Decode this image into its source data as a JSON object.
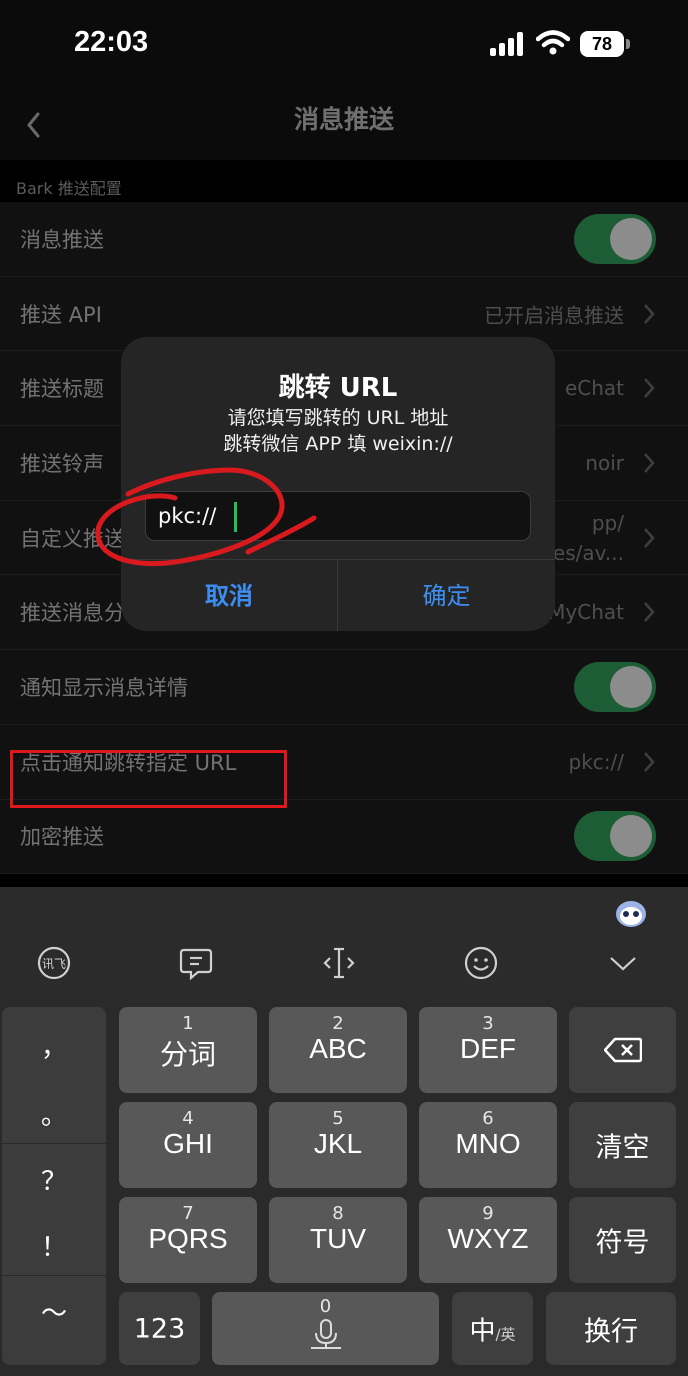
{
  "status": {
    "time": "22:03",
    "battery": "78"
  },
  "nav": {
    "title": "消息推送"
  },
  "section_header": "Bark 推送配置",
  "rows": [
    {
      "label": "消息推送",
      "toggle": true
    },
    {
      "label": "推送 API",
      "value": "已开启消息推送"
    },
    {
      "label": "推送标题",
      "value": "eChat"
    },
    {
      "label": "推送铃声",
      "value": "noir"
    },
    {
      "label": "自定义推送",
      "value_line1": "pp/",
      "value_line2": "es/av..."
    },
    {
      "label": "推送消息分组",
      "value": "MyChat"
    },
    {
      "label": "通知显示消息详情",
      "toggle": true
    },
    {
      "label": "点击通知跳转指定 URL",
      "value": "pkc://"
    },
    {
      "label": "加密推送",
      "toggle": true
    }
  ],
  "dialog": {
    "title": "跳转 URL",
    "message_line1": "请您填写跳转的 URL 地址",
    "message_line2": "跳转微信 APP 填 weixin://",
    "input_value": "pkc://",
    "cancel_label": "取消",
    "confirm_label": "确定"
  },
  "keyboard": {
    "punctuation": [
      "，",
      "。",
      "？",
      "！",
      "～"
    ],
    "keys": [
      {
        "num": "1",
        "main": "分词"
      },
      {
        "num": "2",
        "main": "ABC"
      },
      {
        "num": "3",
        "main": "DEF"
      },
      {
        "num": "4",
        "main": "GHI"
      },
      {
        "num": "5",
        "main": "JKL"
      },
      {
        "num": "6",
        "main": "MNO"
      },
      {
        "num": "7",
        "main": "PQRS"
      },
      {
        "num": "8",
        "main": "TUV"
      },
      {
        "num": "9",
        "main": "WXYZ"
      }
    ],
    "clear_label": "清空",
    "symbol_label": "符号",
    "numbers_label": "123",
    "space_num": "0",
    "lang_main": "中",
    "lang_sub": "/英",
    "return_label": "换行"
  },
  "icons": [
    "back-chevron-icon",
    "signal-icon",
    "wifi-icon",
    "battery-icon",
    "chevron-right-icon",
    "xunfei-voice-icon",
    "comment-icon",
    "cursor-icon",
    "emoji-icon",
    "collapse-keyboard-icon",
    "backspace-icon",
    "microphone-icon",
    "mascot-icon"
  ],
  "colors": {
    "toggle_on": "#1d5d35",
    "accent_blue": "#3d8ef2",
    "annotation_red": "#e0181b",
    "caret_green": "#21c15a"
  }
}
